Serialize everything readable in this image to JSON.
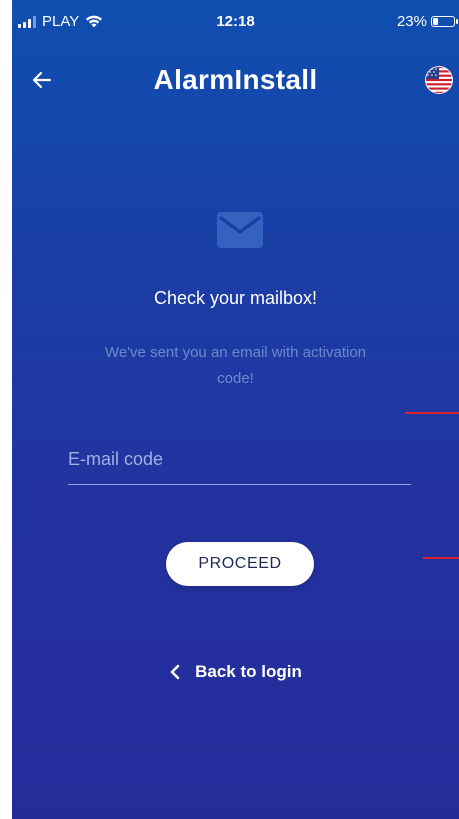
{
  "status_bar": {
    "carrier": "PLAY",
    "time": "12:18",
    "battery": "23%",
    "battery_level": 0.23
  },
  "header": {
    "title": "AlarmInstall",
    "back_icon": "arrow-left-icon",
    "language_icon": "us-flag-icon"
  },
  "content": {
    "mail_icon": "envelope-icon",
    "heading": "Check your mailbox!",
    "subtitle": "We've sent you an email with activation code!"
  },
  "form": {
    "code_value": "",
    "code_placeholder": "E-mail code",
    "proceed_label": "PROCEED"
  },
  "footer": {
    "back_label": "Back to login",
    "back_icon": "chevron-left-icon"
  },
  "colors": {
    "gradient_top": "#0f4fb0",
    "gradient_bottom": "#262b9a",
    "subtitle": "#6f88cc",
    "annotation_red": "#e0212e"
  }
}
